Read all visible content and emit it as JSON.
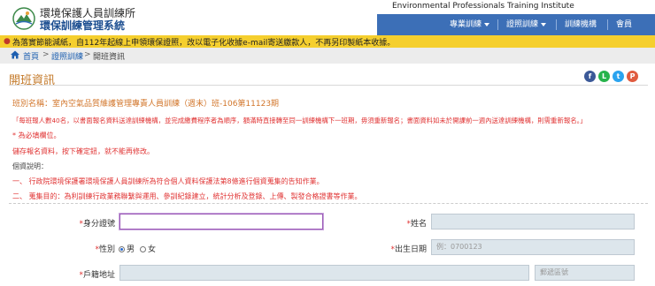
{
  "header": {
    "org_name": "環境保護人員訓練所",
    "system_name": "環保訓練管理系統",
    "english_name": "Environmental Professionals Training Institute",
    "nav": [
      {
        "label": "專業訓練"
      },
      {
        "label": "證照訓練"
      },
      {
        "label": "訓練機構"
      },
      {
        "label": "會員"
      }
    ]
  },
  "notice": {
    "text": "為落實節能減紙，自112年起線上申領環保證照，改以電子化收據e-mail寄送繳款人，不再另印製紙本收據。"
  },
  "breadcrumb": {
    "home": "首頁",
    "section": "證照訓練",
    "current": "開班資訊",
    "separator": ">"
  },
  "page": {
    "title": "開班資訊",
    "social": [
      {
        "icon": "facebook-icon",
        "glyph": "f",
        "color": "#3b5998"
      },
      {
        "icon": "line-icon",
        "glyph": "L",
        "color": "#27b34b"
      },
      {
        "icon": "twitter-icon",
        "glyph": "t",
        "color": "#2aa3ef"
      },
      {
        "icon": "plurk-icon",
        "glyph": "P",
        "color": "#e05b3f"
      }
    ]
  },
  "info": {
    "class_name": "班別名稱：室內空氣品質維護管理專責人員訓練（週末）班-106第11123期",
    "rule_main": "「每班報人數40名，以書面報名資料送達訓練機構，並完成繳費程序者為順序，額滿時直接轉至同一訓練機構下一班期，毋須重新報名；書面資料如未於開課前一週內送達訓練機構，則需重新報名。」",
    "required_note": "* 為必填欄位。",
    "confirm_note": "儲存報名資料，按下確定鈕，就不能再修改。",
    "personal_title": "個資說明：",
    "item_1": "一、 行政院環境保護署環境保護人員訓練所為符合個人資料保護法第8條進行個資蒐集的告知作業。",
    "item_2": "二、 蒐集目的：為利訓練行政業務聯繫與運用、參訓紀錄建立，統計分析及登錄、上傳、製發合格證書等作業。"
  },
  "form": {
    "id_label": "身分證號",
    "name_label": "姓名",
    "gender_label": "性別",
    "gender_options": [
      "男",
      "女"
    ],
    "gender_selected": "男",
    "birthdate_label": "出生日期",
    "birthdate_placeholder": "例：0700123",
    "address_label": "戶籍地址",
    "postal_placeholder": "郵遞區號",
    "required_mark": "*"
  },
  "colors": {
    "nav_bg": "#3c6fb7",
    "notice_bg": "#f5cf2e",
    "title": "#c47a2a",
    "required": "#e03333"
  }
}
